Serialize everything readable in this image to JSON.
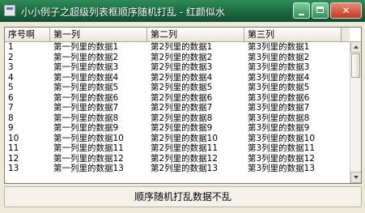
{
  "window": {
    "title": "小小例子之超级列表框顺序随机打乱 - 红颜似水",
    "minimize_label": "",
    "maximize_label": "",
    "close_label": "✕"
  },
  "list": {
    "columns": [
      "序号啊",
      "第一列",
      "第二列",
      "第三列"
    ],
    "rows": [
      [
        "1",
        "第一列里的数据1",
        "第2列里的数据1",
        "第3列里的数据1"
      ],
      [
        "2",
        "第一列里的数据2",
        "第2列里的数据2",
        "第3列里的数据2"
      ],
      [
        "3",
        "第一列里的数据3",
        "第2列里的数据3",
        "第3列里的数据3"
      ],
      [
        "4",
        "第一列里的数据4",
        "第2列里的数据4",
        "第3列里的数据4"
      ],
      [
        "5",
        "第一列里的数据5",
        "第2列里的数据5",
        "第3列里的数据5"
      ],
      [
        "6",
        "第一列里的数据6",
        "第2列里的数据6",
        "第3列里的数据6"
      ],
      [
        "7",
        "第一列里的数据7",
        "第2列里的数据7",
        "第3列里的数据7"
      ],
      [
        "8",
        "第一列里的数据8",
        "第2列里的数据8",
        "第3列里的数据8"
      ],
      [
        "9",
        "第一列里的数据9",
        "第2列里的数据9",
        "第3列里的数据9"
      ],
      [
        "10",
        "第一列里的数据10",
        "第2列里的数据10",
        "第3列里的数据10"
      ],
      [
        "11",
        "第一列里的数据11",
        "第2列里的数据11",
        "第3列里的数据11"
      ],
      [
        "12",
        "第一列里的数据12",
        "第2列里的数据12",
        "第3列里的数据12"
      ],
      [
        "13",
        "第一列里的数据13",
        "第2列里的数据13",
        "第3列里的数据13"
      ]
    ]
  },
  "status": {
    "text": "顺序随机打乱数据不乱"
  },
  "colors": {
    "titlebar": "#1f6f45",
    "close_button": "#c13a1f",
    "background": "#ece9d8"
  }
}
